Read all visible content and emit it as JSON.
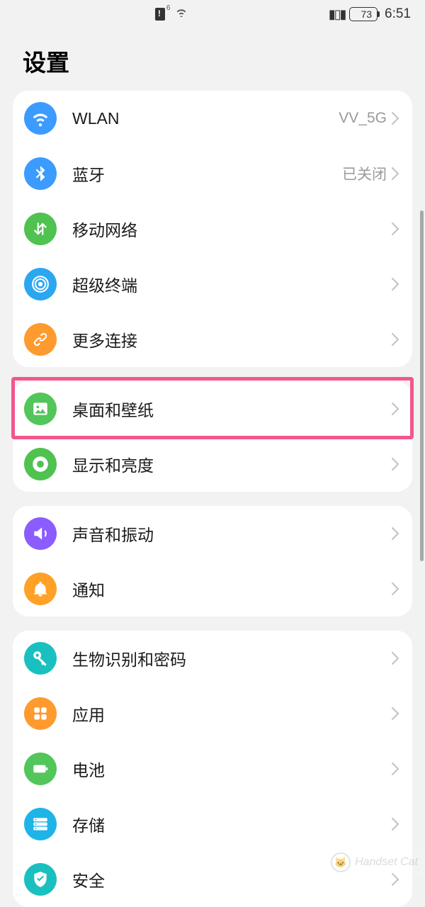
{
  "status": {
    "wifi_badge": "6",
    "battery_pct": "73",
    "time": "6:51"
  },
  "title": "设置",
  "groups": [
    {
      "rows": [
        {
          "id": "wlan",
          "label": "WLAN",
          "value": "VV_5G",
          "icon": "wifi-icon",
          "color": "c-blue"
        },
        {
          "id": "bluetooth",
          "label": "蓝牙",
          "value": "已关闭",
          "icon": "bluetooth-icon",
          "color": "c-blue"
        },
        {
          "id": "mobile",
          "label": "移动网络",
          "value": "",
          "icon": "mobile-data-icon",
          "color": "c-green"
        },
        {
          "id": "super-device",
          "label": "超级终端",
          "value": "",
          "icon": "super-device-icon",
          "color": "c-blue2"
        },
        {
          "id": "more-conn",
          "label": "更多连接",
          "value": "",
          "icon": "link-icon",
          "color": "c-orange"
        }
      ]
    },
    {
      "rows": [
        {
          "id": "home-wallpaper",
          "label": "桌面和壁纸",
          "value": "",
          "icon": "wallpaper-icon",
          "color": "c-green2",
          "highlight": true
        },
        {
          "id": "display",
          "label": "显示和亮度",
          "value": "",
          "icon": "display-icon",
          "color": "c-green"
        }
      ]
    },
    {
      "rows": [
        {
          "id": "sound",
          "label": "声音和振动",
          "value": "",
          "icon": "sound-icon",
          "color": "c-purple"
        },
        {
          "id": "notifications",
          "label": "通知",
          "value": "",
          "icon": "bell-icon",
          "color": "c-orange2"
        }
      ]
    },
    {
      "rows": [
        {
          "id": "biometrics",
          "label": "生物识别和密码",
          "value": "",
          "icon": "key-icon",
          "color": "c-teal"
        },
        {
          "id": "apps",
          "label": "应用",
          "value": "",
          "icon": "apps-icon",
          "color": "c-orange"
        },
        {
          "id": "battery",
          "label": "电池",
          "value": "",
          "icon": "battery-icon",
          "color": "c-green2"
        },
        {
          "id": "storage",
          "label": "存储",
          "value": "",
          "icon": "storage-icon",
          "color": "c-sky"
        },
        {
          "id": "security",
          "label": "安全",
          "value": "",
          "icon": "shield-icon",
          "color": "c-teal"
        }
      ]
    }
  ],
  "watermark": "Handset Cat"
}
